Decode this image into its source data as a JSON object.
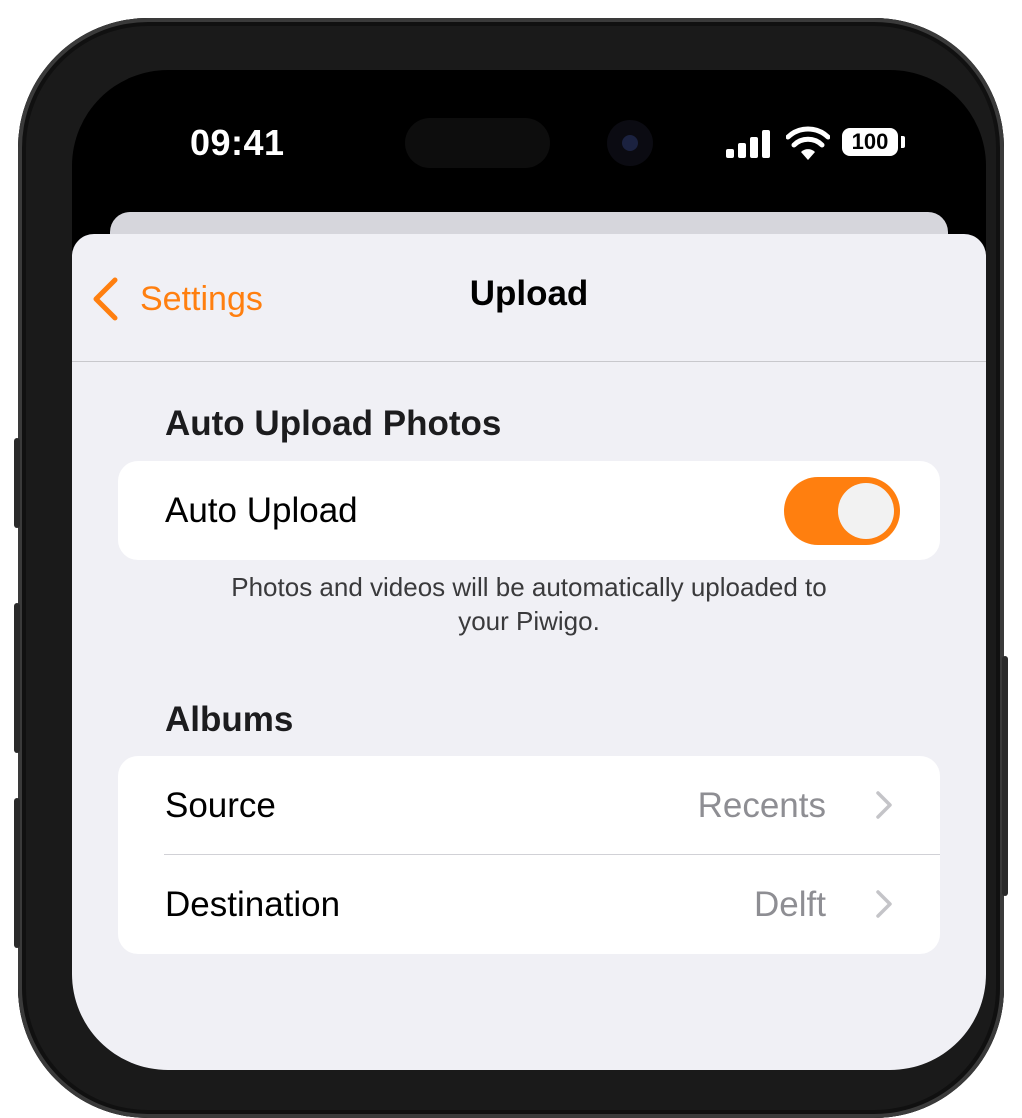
{
  "status_bar": {
    "time": "09:41",
    "battery": "100"
  },
  "nav": {
    "back_label": "Settings",
    "title": "Upload"
  },
  "auto_upload": {
    "header": "Auto Upload Photos",
    "toggle_label": "Auto Upload",
    "toggle_on": true,
    "footer_line1": "Photos and videos will be automatically uploaded to",
    "footer_line2": "your Piwigo."
  },
  "albums": {
    "header": "Albums",
    "rows": [
      {
        "label": "Source",
        "value": "Recents"
      },
      {
        "label": "Destination",
        "value": "Delft"
      }
    ]
  },
  "colors": {
    "accent": "#ff7f0f",
    "background": "#f0f0f5",
    "card": "#ffffff",
    "secondary_text": "#8e8e93"
  }
}
